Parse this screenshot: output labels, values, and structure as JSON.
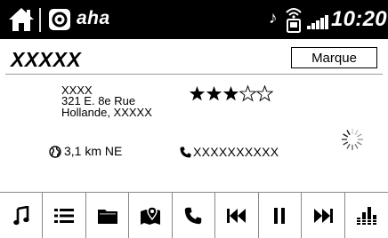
{
  "status_bar": {
    "app_name": "aha",
    "time": "10:20",
    "icons": [
      "home-icon",
      "aha-logo-icon",
      "music-note-icon",
      "phone-wifi-icon",
      "signal-strength-icon"
    ]
  },
  "station": {
    "title": "XXXXX",
    "marque_label": "Marque",
    "address_line1": "XXXX",
    "address_line2": "321 E. 8e Rue",
    "address_line3": "Hollande, XXXXX",
    "rating": 3,
    "rating_max": 5,
    "distance": "3,1 km NE",
    "phone": "XXXXXXXXXX"
  },
  "toolbar": {
    "buttons": [
      "music-icon",
      "list-icon",
      "folder-icon",
      "map-pin-icon",
      "phone-icon",
      "previous-track-icon",
      "pause-icon",
      "next-track-icon",
      "equalizer-icon"
    ]
  }
}
